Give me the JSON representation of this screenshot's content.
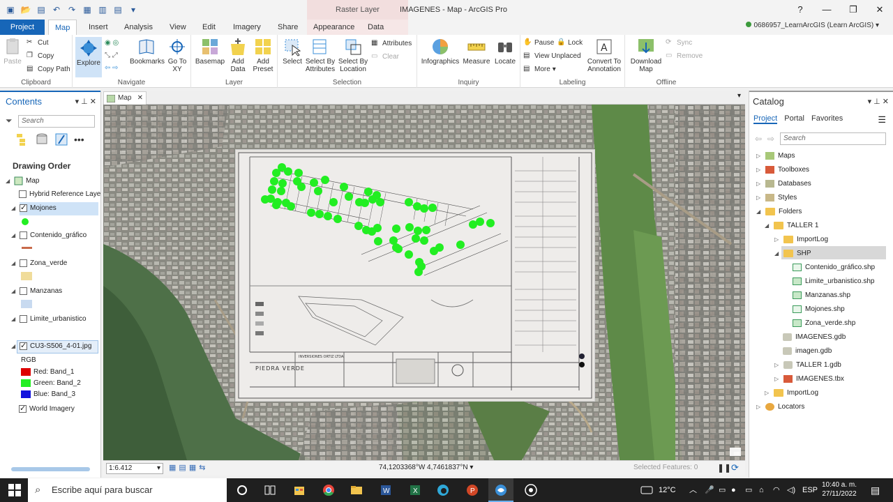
{
  "titlebar": {
    "context_tab_group": "Raster Layer",
    "title": "IMAGENES - Map - ArcGIS Pro",
    "help": "?",
    "minimize": "—",
    "maximize": "❐",
    "close": "✕"
  },
  "tabs": [
    {
      "label": "Project"
    },
    {
      "label": "Map"
    },
    {
      "label": "Insert"
    },
    {
      "label": "Analysis"
    },
    {
      "label": "View"
    },
    {
      "label": "Edit"
    },
    {
      "label": "Imagery"
    },
    {
      "label": "Share"
    },
    {
      "label": "Appearance"
    },
    {
      "label": "Data"
    }
  ],
  "user": "0686957_LearnArcGIS (Learn ArcGIS) ▾",
  "ribbon": {
    "clipboard": {
      "paste": "Paste",
      "cut": "Cut",
      "copy": "Copy",
      "copy_path": "Copy Path",
      "label": "Clipboard"
    },
    "navigate": {
      "explore": "Explore",
      "bookmarks": "Bookmarks",
      "go_to_xy": "Go To XY",
      "label": "Navigate"
    },
    "layer": {
      "basemap": "Basemap",
      "add_data": "Add Data",
      "add_preset": "Add Preset",
      "label": "Layer"
    },
    "selection": {
      "select": "Select",
      "select_by_attributes": "Select By Attributes",
      "select_by_location": "Select By Location",
      "attributes": "Attributes",
      "clear": "Clear",
      "label": "Selection"
    },
    "inquiry": {
      "infographics": "Infographics",
      "measure": "Measure",
      "locate": "Locate",
      "label": "Inquiry"
    },
    "labeling": {
      "pause": "Pause",
      "lock": "Lock",
      "view_unplaced": "View Unplaced",
      "more": "More",
      "convert": "Convert To Annotation",
      "label": "Labeling"
    },
    "offline": {
      "download_map": "Download Map",
      "sync": "Sync",
      "remove": "Remove",
      "label": "Offline"
    }
  },
  "contents": {
    "title": "Contents",
    "search_placeholder": "Search",
    "drawing_order": "Drawing Order",
    "map": "Map",
    "layers": [
      {
        "name": "Hybrid Reference Laye",
        "checked": false
      },
      {
        "name": "Mojones",
        "checked": true
      },
      {
        "name": "Contenido_gráfico",
        "checked": false
      },
      {
        "name": "Zona_verde",
        "checked": false
      },
      {
        "name": "Manzanas",
        "checked": false
      },
      {
        "name": "Limite_urbanistico",
        "checked": false
      },
      {
        "name": "CU3-S506_4-01.jpg",
        "checked": true
      }
    ],
    "rgb": "RGB",
    "bands": [
      "Red:  Band_1",
      "Green: Band_2",
      "Blue:  Band_3"
    ],
    "world_imagery": "World Imagery"
  },
  "map": {
    "tab_label": "Map",
    "scale": "1:6.412",
    "coordinates": "74,1203368°W 4,7461837°N",
    "selected_features": "Selected Features: 0",
    "plan_title": "PIEDRA VERDE",
    "plan_company": "INVERSIONES ORTIZ LTDA"
  },
  "catalog": {
    "title": "Catalog",
    "tabs": [
      "Project",
      "Portal",
      "Favorites"
    ],
    "search_placeholder": "Search",
    "items": [
      {
        "label": "Maps"
      },
      {
        "label": "Toolboxes"
      },
      {
        "label": "Databases"
      },
      {
        "label": "Styles"
      },
      {
        "label": "Folders"
      },
      {
        "label": "TALLER 1"
      },
      {
        "label": "ImportLog"
      },
      {
        "label": "SHP"
      },
      {
        "label": "Contenido_gráfico.shp"
      },
      {
        "label": "Limite_urbanistico.shp"
      },
      {
        "label": "Manzanas.shp"
      },
      {
        "label": "Mojones.shp"
      },
      {
        "label": "Zona_verde.shp"
      },
      {
        "label": "IMAGENES.gdb"
      },
      {
        "label": "imagen.gdb"
      },
      {
        "label": "TALLER 1.gdb"
      },
      {
        "label": "IMAGENES.tbx"
      },
      {
        "label": "ImportLog"
      },
      {
        "label": "Locators"
      }
    ]
  },
  "taskbar": {
    "search_placeholder": "Escribe aquí para buscar",
    "temperature": "12°C",
    "language": "ESP",
    "time": "10:40 a. m.",
    "date": "27/11/2022"
  },
  "colors": {
    "accent": "#1766b8",
    "point_green": "#22ee22"
  }
}
